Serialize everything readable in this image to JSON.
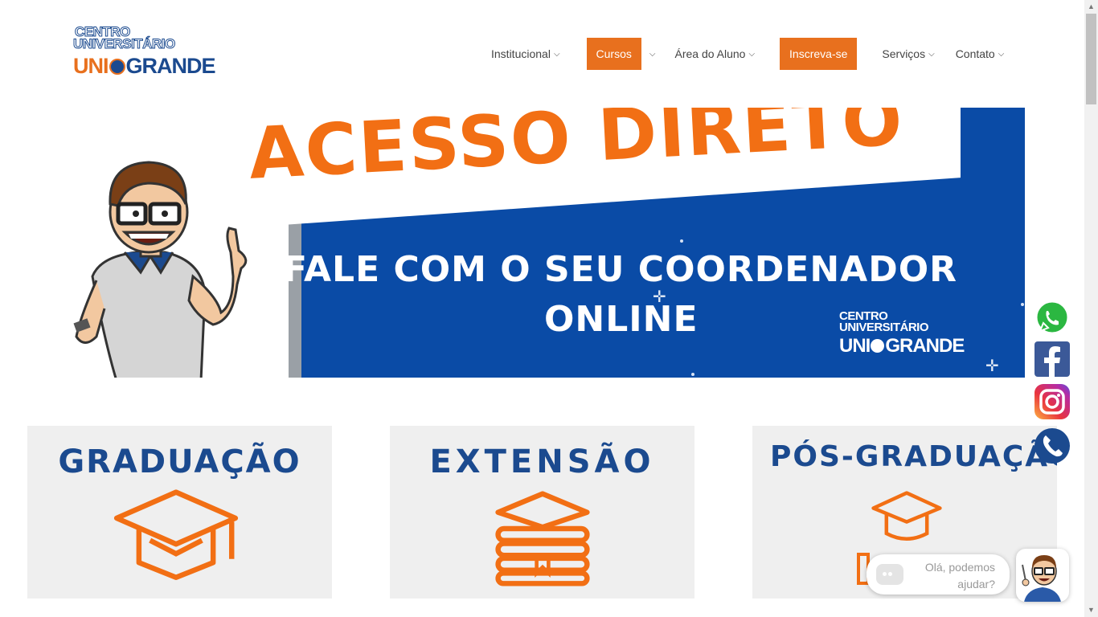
{
  "logo": {
    "line1": "CENTRO",
    "line2": "UNIVERSITÁRIO",
    "uni": "UNI",
    "grande": "GRANDE"
  },
  "nav": {
    "items": [
      {
        "label": "Institucional",
        "chevron": "⌵"
      },
      {
        "label": "Cursos"
      },
      {
        "label": "Área do Aluno",
        "chevron": "⌵"
      },
      {
        "label": "Inscreva-se"
      },
      {
        "label": "Serviços",
        "chevron": "⌵"
      },
      {
        "label": "Contato",
        "chevron": "⌵"
      }
    ],
    "cursos_caret": "⌵"
  },
  "banner": {
    "headline": "ACESSO DIRETO",
    "subline1": "FALE COM O SEU COORDENADOR",
    "subline2": "ONLINE",
    "logo_line1": "CENTRO",
    "logo_line2": "UNIVERSITÁRIO",
    "logo_uni": "UNI",
    "logo_grande": "GRANDE"
  },
  "cards": [
    {
      "title": "GRADUAÇÃO",
      "icon": "graduation-cap-icon"
    },
    {
      "title": "EXTENSÃO",
      "icon": "books-icon"
    },
    {
      "title": "PÓS-GRADUAÇÃO",
      "icon": "graduation-cap-icon"
    }
  ],
  "social": [
    "whatsapp-icon",
    "facebook-icon",
    "instagram-icon",
    "phone-icon"
  ],
  "chat": {
    "line1": "Olá, podemos",
    "line2": "ajudar?"
  },
  "colors": {
    "brand_blue": "#1b4a8f",
    "brand_orange": "#e8701e",
    "banner_blue": "#0a4ba6",
    "card_bg": "#efefef"
  }
}
